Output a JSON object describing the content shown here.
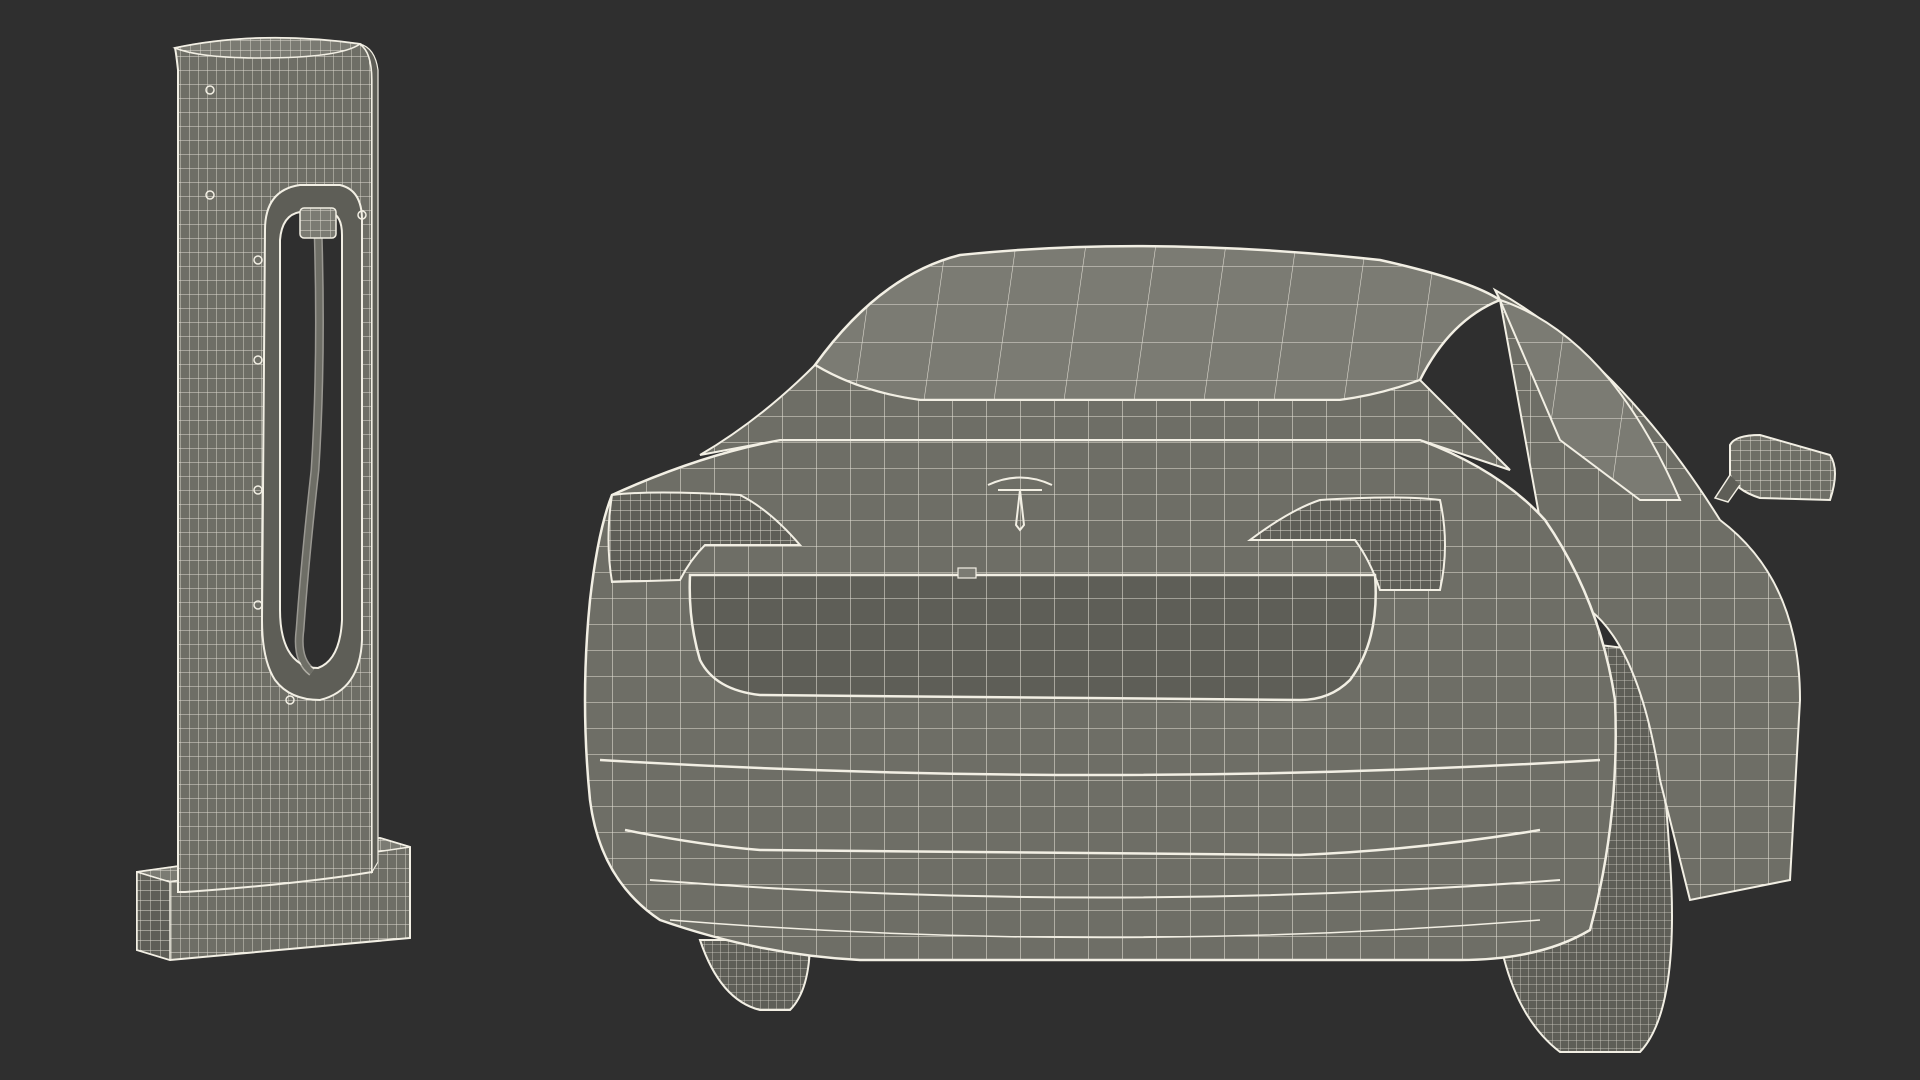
{
  "scene": {
    "background_color": "#2f2f2f",
    "mesh_fill_color": "#6e6e66",
    "mesh_fill_light": "#7b7b73",
    "mesh_fill_dark": "#5e5e57",
    "wire_color": "#f2efe4",
    "subjects": [
      "charging-station",
      "electric-car"
    ]
  }
}
